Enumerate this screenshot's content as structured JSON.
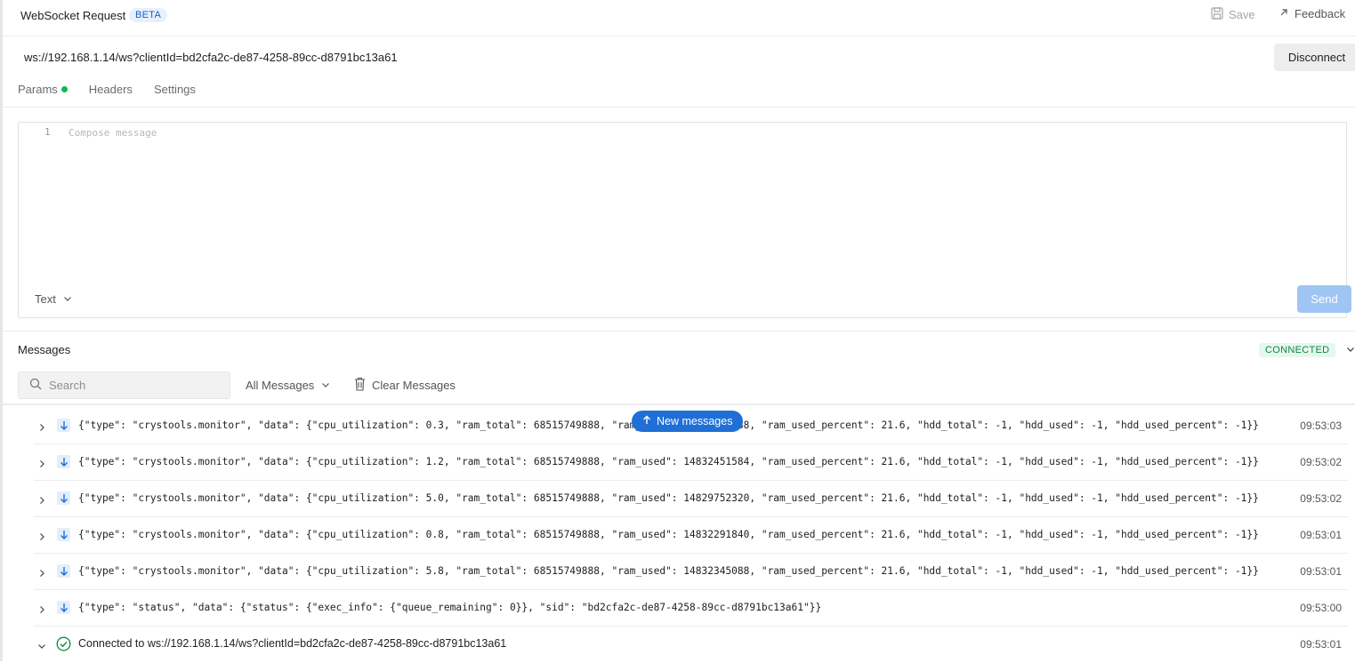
{
  "header": {
    "title": "WebSocket Request",
    "badge": "BETA",
    "save_label": "Save",
    "feedback_label": "Feedback"
  },
  "url": {
    "value": "ws://192.168.1.14/ws?clientId=bd2cfa2c-de87-4258-89cc-d8791bc13a61",
    "disconnect_label": "Disconnect"
  },
  "tabs": [
    {
      "label": "Params",
      "has_dot": true
    },
    {
      "label": "Headers"
    },
    {
      "label": "Settings"
    }
  ],
  "composer": {
    "line_number": "1",
    "placeholder": "Compose message",
    "type_label": "Text",
    "send_label": "Send"
  },
  "messages": {
    "title": "Messages",
    "status": "CONNECTED",
    "search_placeholder": "Search",
    "filter_label": "All Messages",
    "clear_label": "Clear Messages",
    "new_messages_label": "New messages",
    "items": [
      {
        "text": "{\"type\": \"crystools.monitor\", \"data\": {\"cpu_utilization\": 0.3, \"ram_total\": 68515749888, \"ram_used\": 14832242688, \"ram_used_percent\": 21.6, \"hdd_total\": -1, \"hdd_used\": -1, \"hdd_used_percent\": -1}}",
        "time": "09:53:03"
      },
      {
        "text": "{\"type\": \"crystools.monitor\", \"data\": {\"cpu_utilization\": 1.2, \"ram_total\": 68515749888, \"ram_used\": 14832451584, \"ram_used_percent\": 21.6, \"hdd_total\": -1, \"hdd_used\": -1, \"hdd_used_percent\": -1}}",
        "time": "09:53:02"
      },
      {
        "text": "{\"type\": \"crystools.monitor\", \"data\": {\"cpu_utilization\": 5.0, \"ram_total\": 68515749888, \"ram_used\": 14829752320, \"ram_used_percent\": 21.6, \"hdd_total\": -1, \"hdd_used\": -1, \"hdd_used_percent\": -1}}",
        "time": "09:53:02"
      },
      {
        "text": "{\"type\": \"crystools.monitor\", \"data\": {\"cpu_utilization\": 0.8, \"ram_total\": 68515749888, \"ram_used\": 14832291840, \"ram_used_percent\": 21.6, \"hdd_total\": -1, \"hdd_used\": -1, \"hdd_used_percent\": -1}}",
        "time": "09:53:01"
      },
      {
        "text": "{\"type\": \"crystools.monitor\", \"data\": {\"cpu_utilization\": 5.8, \"ram_total\": 68515749888, \"ram_used\": 14832345088, \"ram_used_percent\": 21.6, \"hdd_total\": -1, \"hdd_used\": -1, \"hdd_used_percent\": -1}}",
        "time": "09:53:01"
      },
      {
        "text": "{\"type\": \"status\", \"data\": {\"status\": {\"exec_info\": {\"queue_remaining\": 0}}, \"sid\": \"bd2cfa2c-de87-4258-89cc-d8791bc13a61\"}}",
        "time": "09:53:00"
      }
    ],
    "connected_event": {
      "text": "Connected to ws://192.168.1.14/ws?clientId=bd2cfa2c-de87-4258-89cc-d8791bc13a61",
      "time": "09:53:01"
    }
  },
  "colors": {
    "accent": "#1f6fd6",
    "send_disabled": "#9fc5f5",
    "connected_green": "#0c8a3f",
    "dot_green": "#0cbb52"
  }
}
